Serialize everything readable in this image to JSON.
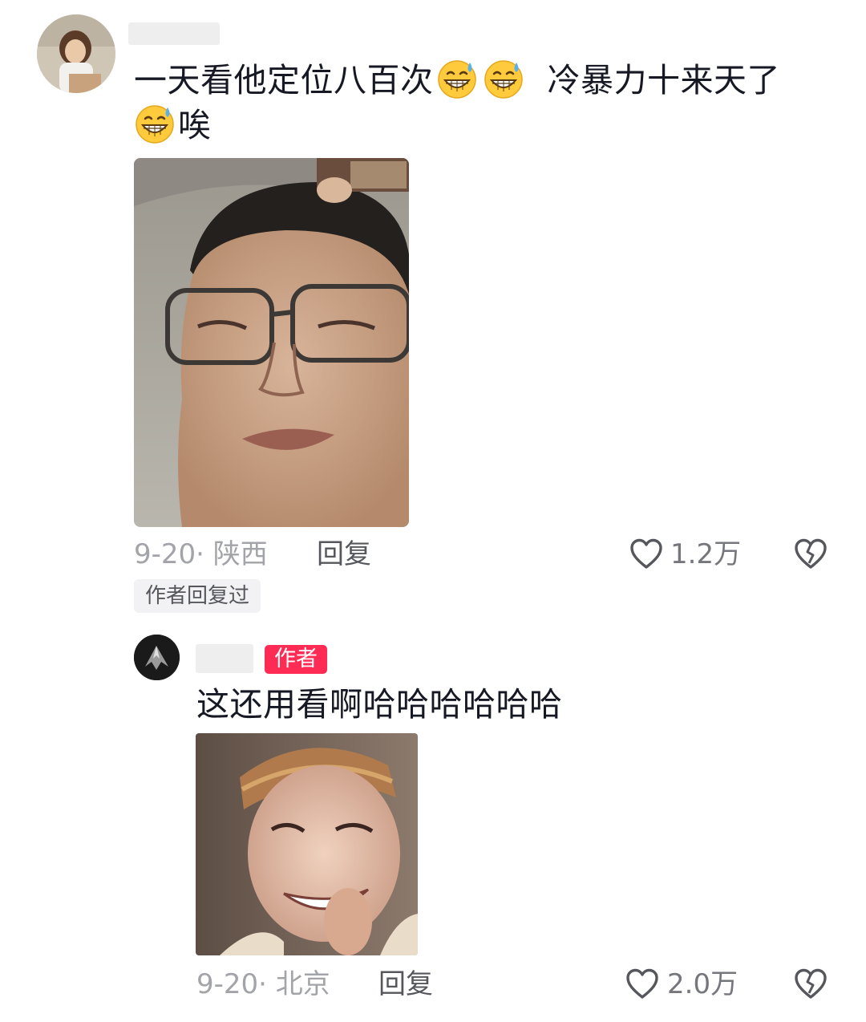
{
  "comment": {
    "text_part1": "一天看他定位八百次",
    "text_part2": "冷暴力十来天了",
    "text_part3": "唉",
    "emoji_icon": "grinning-sweat-emoji",
    "date_location": "9-20· 陕西",
    "reply_label": "回复",
    "like_count": "1.2万",
    "author_replied_label": "作者回复过"
  },
  "reply": {
    "author_badge": "作者",
    "text": "这还用看啊哈哈哈哈哈哈",
    "date_location": "9-20· 北京",
    "reply_label": "回复",
    "like_count": "2.0万"
  },
  "colors": {
    "accent": "#fe2c55",
    "meta_gray": "#a3a4a9"
  }
}
